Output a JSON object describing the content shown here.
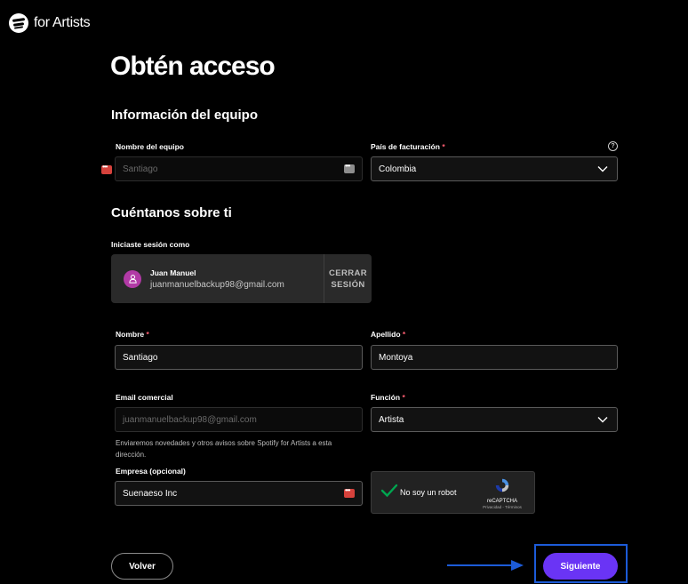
{
  "brand": {
    "logo_text": "for Artists"
  },
  "page": {
    "title": "Obtén acceso"
  },
  "team_section": {
    "heading": "Información del equipo",
    "team_name": {
      "label": "Nombre del equipo",
      "value": "Santiago"
    },
    "billing_country": {
      "label": "País de facturación",
      "required_mark": "*",
      "value": "Colombia",
      "help_icon": "?"
    }
  },
  "about_section": {
    "heading": "Cuéntanos sobre ti",
    "session": {
      "label": "Iniciaste sesión como",
      "user_name": "Juan Manuel",
      "email": "juanmanuelbackup98@gmail.com",
      "logout_line1": "CERRAR",
      "logout_line2": "SESIÓN"
    },
    "first_name": {
      "label": "Nombre",
      "required_mark": "*",
      "value": "Santiago"
    },
    "last_name": {
      "label": "Apellido",
      "required_mark": "*",
      "value": "Montoya"
    },
    "business_email": {
      "label": "Email comercial",
      "value": "juanmanuelbackup98@gmail.com",
      "note_line1": "Enviaremos novedades y otros avisos sobre Spotify for Artists a esta",
      "note_line2": "dirección."
    },
    "role": {
      "label": "Función",
      "required_mark": "*",
      "value": "Artista"
    },
    "company": {
      "label": "Empresa (opcional)",
      "value": "Suenaeso Inc"
    }
  },
  "captcha": {
    "text": "No soy un robot",
    "brand": "reCAPTCHA",
    "links": "Privacidad - Términos"
  },
  "actions": {
    "back_label": "Volver",
    "next_label": "Siguiente"
  },
  "colors": {
    "accent": "#6a34f5",
    "highlight_frame": "#1c5bd8",
    "required": "#ff5f73",
    "captcha_check": "#00a650"
  }
}
